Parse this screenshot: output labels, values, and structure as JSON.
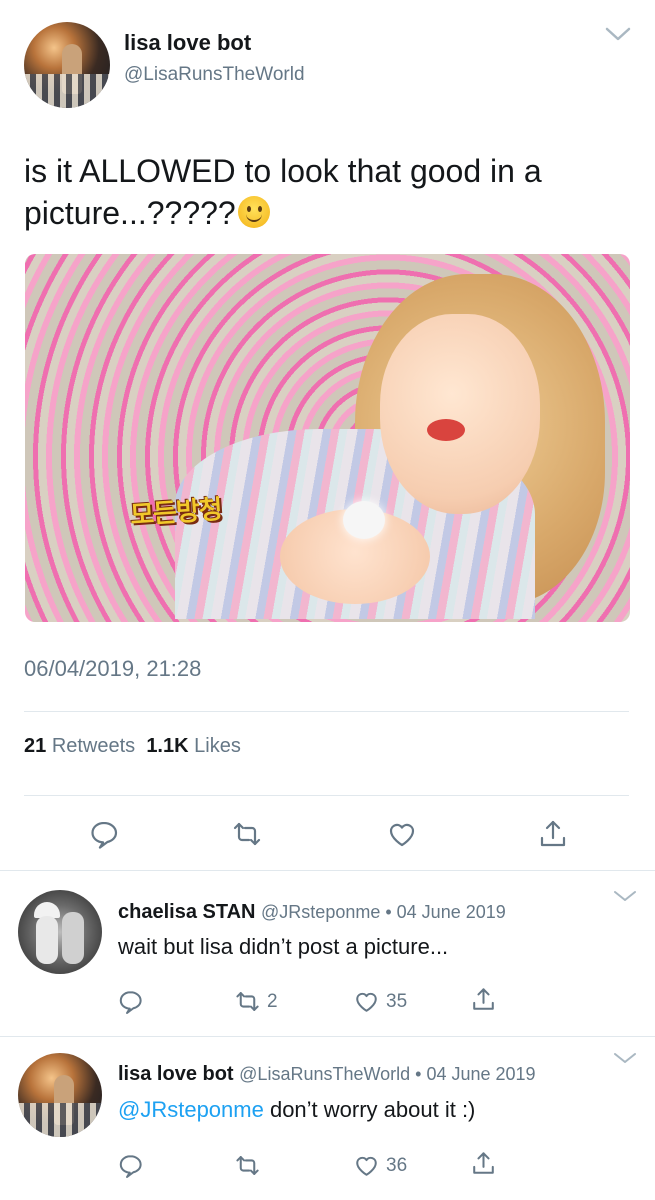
{
  "tweet": {
    "display_name": "lisa love bot",
    "handle": "@LisaRunsTheWorld",
    "text": "is it ALLOWED to look that good in a picture...?????",
    "emoji": "slightly-smiling-face-emoji",
    "image_caption": "모든방청",
    "datetime": "06/04/2019, 21:28",
    "retweets_count": "21",
    "retweets_label": "Retweets",
    "likes_count": "1.1K",
    "likes_label": "Likes"
  },
  "replies": [
    {
      "display_name": "chaelisa STAN",
      "meta": "@JRsteponme • 04 June 2019",
      "mention": "",
      "text": "wait but lisa didn’t post a picture...",
      "retweets": "2",
      "likes": "35"
    },
    {
      "display_name": "lisa love bot",
      "meta": "@LisaRunsTheWorld • 04 June 2019",
      "mention": "@JRsteponme",
      "text": " don’t worry about it :)",
      "retweets": "",
      "likes": "36"
    }
  ],
  "colors": {
    "text": "#14171a",
    "secondary": "#657786",
    "link": "#1da1f2",
    "divider": "#e1e8ed"
  },
  "icons": [
    "chevron-down-icon",
    "reply-icon",
    "retweet-icon",
    "like-icon",
    "share-icon"
  ]
}
